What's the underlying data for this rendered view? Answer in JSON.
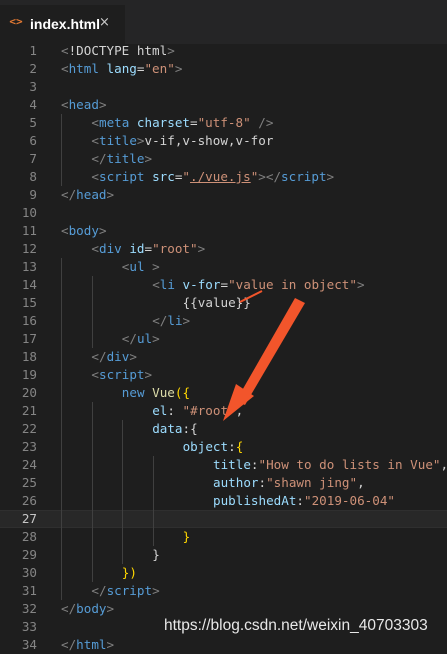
{
  "tab": {
    "icon": "html-file-icon",
    "label": "index.html",
    "close": "×"
  },
  "lines": [
    {
      "n": "1",
      "indent": 0,
      "tokens": [
        [
          "t-punc",
          "<"
        ],
        [
          "t-plain",
          "!DOCTYPE "
        ],
        [
          "t-plain",
          "html"
        ],
        [
          "t-punc",
          ">"
        ]
      ]
    },
    {
      "n": "2",
      "indent": 0,
      "tokens": [
        [
          "t-punc",
          "<"
        ],
        [
          "t-tag",
          "html"
        ],
        [
          "t-plain",
          " "
        ],
        [
          "t-attr",
          "lang"
        ],
        [
          "t-plain",
          "="
        ],
        [
          "t-str",
          "\"en\""
        ],
        [
          "t-punc",
          ">"
        ]
      ]
    },
    {
      "n": "3",
      "indent": 0,
      "tokens": []
    },
    {
      "n": "4",
      "indent": 0,
      "tokens": [
        [
          "t-punc",
          "<"
        ],
        [
          "t-tag",
          "head"
        ],
        [
          "t-punc",
          ">"
        ]
      ]
    },
    {
      "n": "5",
      "indent": 1,
      "tokens": [
        [
          "t-punc",
          "<"
        ],
        [
          "t-tag",
          "meta"
        ],
        [
          "t-plain",
          " "
        ],
        [
          "t-attr",
          "charset"
        ],
        [
          "t-plain",
          "="
        ],
        [
          "t-str",
          "\"utf-8\""
        ],
        [
          "t-plain",
          " "
        ],
        [
          "t-punc",
          "/>"
        ]
      ]
    },
    {
      "n": "6",
      "indent": 1,
      "tokens": [
        [
          "t-punc",
          "<"
        ],
        [
          "t-tag",
          "title"
        ],
        [
          "t-punc",
          ">"
        ],
        [
          "t-plain",
          "v-if,v-show,v-for"
        ]
      ]
    },
    {
      "n": "7",
      "indent": 1,
      "tokens": [
        [
          "t-punc",
          "</"
        ],
        [
          "t-tag",
          "title"
        ],
        [
          "t-punc",
          ">"
        ]
      ]
    },
    {
      "n": "8",
      "indent": 1,
      "tokens": [
        [
          "t-punc",
          "<"
        ],
        [
          "t-tag",
          "script"
        ],
        [
          "t-plain",
          " "
        ],
        [
          "t-attr",
          "src"
        ],
        [
          "t-plain",
          "="
        ],
        [
          "t-str",
          "\""
        ],
        [
          "t-str u",
          "./vue.js"
        ],
        [
          "t-str",
          "\""
        ],
        [
          "t-punc",
          "></"
        ],
        [
          "t-tag",
          "script"
        ],
        [
          "t-punc",
          ">"
        ]
      ]
    },
    {
      "n": "9",
      "indent": 0,
      "tokens": [
        [
          "t-punc",
          "</"
        ],
        [
          "t-tag",
          "head"
        ],
        [
          "t-punc",
          ">"
        ]
      ]
    },
    {
      "n": "10",
      "indent": 0,
      "tokens": []
    },
    {
      "n": "11",
      "indent": 0,
      "tokens": [
        [
          "t-punc",
          "<"
        ],
        [
          "t-tag",
          "body"
        ],
        [
          "t-punc",
          ">"
        ]
      ]
    },
    {
      "n": "12",
      "indent": 1,
      "tokens": [
        [
          "t-punc",
          "<"
        ],
        [
          "t-tag",
          "div"
        ],
        [
          "t-plain",
          " "
        ],
        [
          "t-attr",
          "id"
        ],
        [
          "t-plain",
          "="
        ],
        [
          "t-str",
          "\"root\""
        ],
        [
          "t-punc",
          ">"
        ]
      ]
    },
    {
      "n": "13",
      "indent": 2,
      "tokens": [
        [
          "t-punc",
          "<"
        ],
        [
          "t-tag",
          "ul"
        ],
        [
          "t-plain",
          " "
        ],
        [
          "t-punc",
          ">"
        ]
      ]
    },
    {
      "n": "14",
      "indent": 3,
      "tokens": [
        [
          "t-punc",
          "<"
        ],
        [
          "t-tag",
          "li"
        ],
        [
          "t-plain",
          " "
        ],
        [
          "t-attr",
          "v-for"
        ],
        [
          "t-plain",
          "="
        ],
        [
          "t-str",
          "\"value in object\""
        ],
        [
          "t-punc",
          ">"
        ]
      ]
    },
    {
      "n": "15",
      "indent": 4,
      "tokens": [
        [
          "t-plain",
          "{{value}}"
        ]
      ]
    },
    {
      "n": "16",
      "indent": 3,
      "tokens": [
        [
          "t-punc",
          "</"
        ],
        [
          "t-tag",
          "li"
        ],
        [
          "t-punc",
          ">"
        ]
      ]
    },
    {
      "n": "17",
      "indent": 2,
      "tokens": [
        [
          "t-punc",
          "</"
        ],
        [
          "t-tag",
          "ul"
        ],
        [
          "t-punc",
          ">"
        ]
      ]
    },
    {
      "n": "18",
      "indent": 1,
      "tokens": [
        [
          "t-punc",
          "</"
        ],
        [
          "t-tag",
          "div"
        ],
        [
          "t-punc",
          ">"
        ]
      ]
    },
    {
      "n": "19",
      "indent": 1,
      "tokens": [
        [
          "t-punc",
          "<"
        ],
        [
          "t-tag",
          "script"
        ],
        [
          "t-punc",
          ">"
        ]
      ]
    },
    {
      "n": "20",
      "indent": 2,
      "tokens": [
        [
          "t-kw",
          "new "
        ],
        [
          "t-fn",
          "Vue"
        ],
        [
          "t-brace",
          "({"
        ]
      ]
    },
    {
      "n": "21",
      "indent": 3,
      "tokens": [
        [
          "t-key",
          "el"
        ],
        [
          "t-plain",
          ": "
        ],
        [
          "t-str",
          "\"#root\""
        ],
        [
          "t-plain",
          ","
        ]
      ]
    },
    {
      "n": "22",
      "indent": 3,
      "tokens": [
        [
          "t-key",
          "data"
        ],
        [
          "t-plain",
          ":"
        ],
        [
          "t-plain",
          "{"
        ]
      ]
    },
    {
      "n": "23",
      "indent": 4,
      "tokens": [
        [
          "t-key",
          "object"
        ],
        [
          "t-plain",
          ":"
        ],
        [
          "t-brace",
          "{"
        ]
      ]
    },
    {
      "n": "24",
      "indent": 5,
      "tokens": [
        [
          "t-key",
          "title"
        ],
        [
          "t-plain",
          ":"
        ],
        [
          "t-str",
          "\"How to do lists in Vue\""
        ],
        [
          "t-plain",
          ","
        ]
      ]
    },
    {
      "n": "25",
      "indent": 5,
      "tokens": [
        [
          "t-key",
          "author"
        ],
        [
          "t-plain",
          ":"
        ],
        [
          "t-str",
          "\"shawn jing\""
        ],
        [
          "t-plain",
          ","
        ]
      ]
    },
    {
      "n": "26",
      "indent": 5,
      "tokens": [
        [
          "t-key",
          "publishedAt"
        ],
        [
          "t-plain",
          ":"
        ],
        [
          "t-str",
          "\"2019-06-04\""
        ]
      ]
    },
    {
      "n": "27",
      "indent": 0,
      "current": true,
      "tokens": []
    },
    {
      "n": "28",
      "indent": 4,
      "tokens": [
        [
          "t-brace",
          "}"
        ]
      ]
    },
    {
      "n": "29",
      "indent": 3,
      "tokens": [
        [
          "t-plain",
          "}"
        ]
      ]
    },
    {
      "n": "30",
      "indent": 2,
      "tokens": [
        [
          "t-brace",
          "})"
        ]
      ]
    },
    {
      "n": "31",
      "indent": 1,
      "tokens": [
        [
          "t-punc",
          "</"
        ],
        [
          "t-tag",
          "script"
        ],
        [
          "t-punc",
          ">"
        ]
      ]
    },
    {
      "n": "32",
      "indent": 0,
      "tokens": [
        [
          "t-punc",
          "</"
        ],
        [
          "t-tag",
          "body"
        ],
        [
          "t-punc",
          ">"
        ]
      ]
    },
    {
      "n": "33",
      "indent": 0,
      "tokens": []
    },
    {
      "n": "34",
      "indent": 0,
      "tokens": [
        [
          "t-punc",
          "</"
        ],
        [
          "t-tag",
          "html"
        ],
        [
          "t-punc",
          ">"
        ]
      ]
    }
  ],
  "watermark": "https://blog.csdn.net/weixin_40703303",
  "colors": {
    "arrow": "#f2552b",
    "background": "#1e1e1e",
    "tag": "#569cd6",
    "string": "#ce9178"
  }
}
